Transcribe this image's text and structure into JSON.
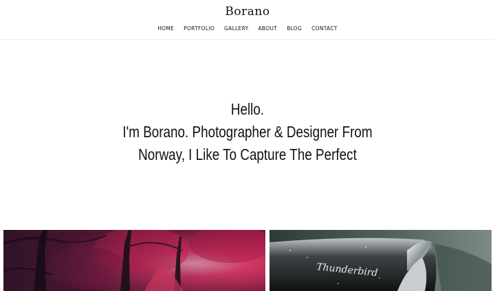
{
  "site": {
    "brand": "Borano"
  },
  "nav": {
    "items": [
      {
        "label": "HOME"
      },
      {
        "label": "PORTFOLIO"
      },
      {
        "label": "GALLERY"
      },
      {
        "label": "ABOUT"
      },
      {
        "label": "BLOG"
      },
      {
        "label": "CONTACT"
      }
    ]
  },
  "hero": {
    "lines": [
      "Hello.",
      "I'm Borano. Photographer & Designer From",
      "Norway, I Like To Capture The Perfect"
    ]
  },
  "gallery": {
    "items": [
      {
        "subject": "red-forest-trees"
      },
      {
        "subject": "classic-car-fin",
        "script_text": "Thunderbird"
      }
    ]
  }
}
